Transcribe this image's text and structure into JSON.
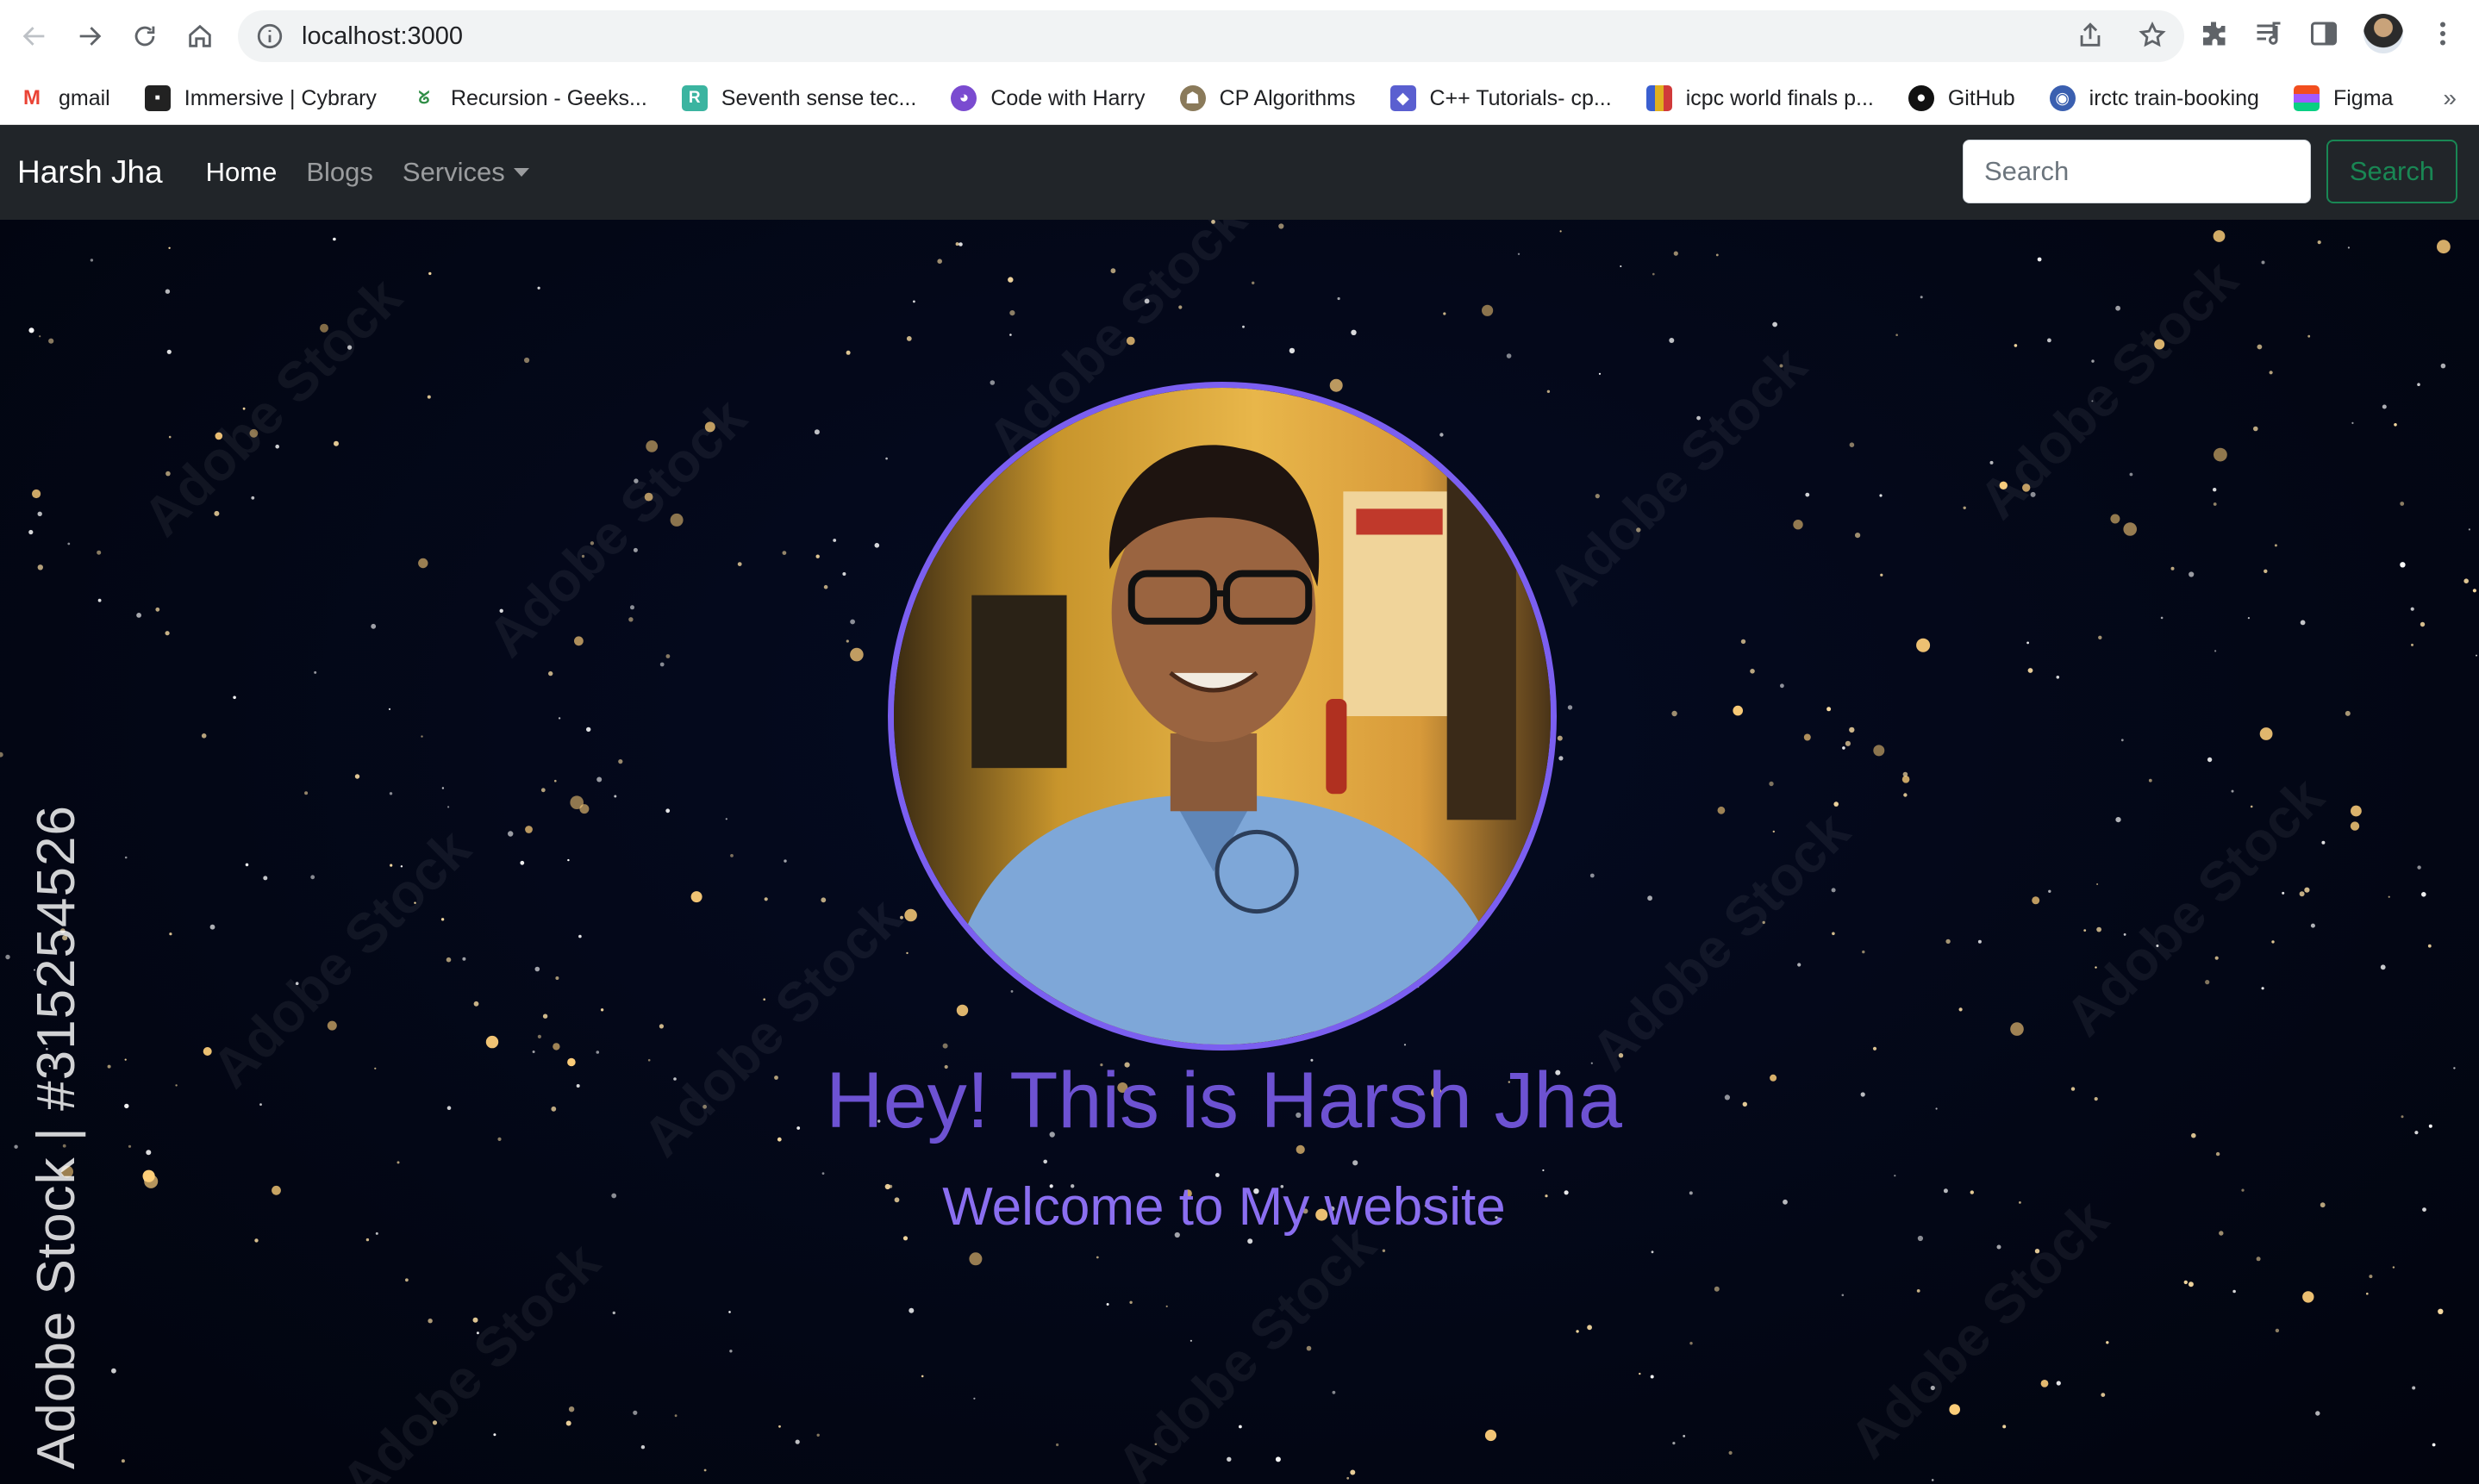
{
  "browser": {
    "url": "localhost:3000",
    "bookmarks": [
      {
        "label": "gmail",
        "icon": "gmail-icon",
        "color": "#ea4335"
      },
      {
        "label": "Immersive | Cybrary",
        "icon": "cybrary-icon",
        "color": "#222222"
      },
      {
        "label": "Recursion - Geeks...",
        "icon": "geeksforgeeks-icon",
        "color": "#2f8d46"
      },
      {
        "label": "Seventh sense tec...",
        "icon": "seventh-sense-icon",
        "color": "#3bb4a0"
      },
      {
        "label": "Code with Harry",
        "icon": "codewithharry-icon",
        "color": "#7a4bd0"
      },
      {
        "label": "CP Algorithms",
        "icon": "cp-algorithms-icon",
        "color": "#8a7a5a"
      },
      {
        "label": "C++ Tutorials- cp...",
        "icon": "cpp-tutorials-icon",
        "color": "#5a5fd0"
      },
      {
        "label": "icpc world finals p...",
        "icon": "icpc-icon",
        "color": "#e0b020"
      },
      {
        "label": "GitHub",
        "icon": "github-icon",
        "color": "#111111"
      },
      {
        "label": "irctc train-booking",
        "icon": "irctc-icon",
        "color": "#3a5fb0"
      },
      {
        "label": "Figma",
        "icon": "figma-icon",
        "color": "#f24e1e"
      }
    ],
    "more": "»"
  },
  "navbar": {
    "brand": "Harsh Jha",
    "links": [
      {
        "label": "Home"
      },
      {
        "label": "Blogs"
      },
      {
        "label": "Services"
      }
    ],
    "search_placeholder": "Search",
    "search_button": "Search",
    "colors": {
      "background": "#212529",
      "search_accent": "#198754"
    }
  },
  "hero": {
    "title": "Hey! This is Harsh Jha",
    "subtitle": "Welcome to My website",
    "watermark_side": "Adobe Stock | #315254526",
    "watermark_repeat": "Adobe Stock",
    "colors": {
      "title": "#6d52d2",
      "subtitle": "#8a6ef0",
      "avatar_border": "#7b5ff0"
    }
  }
}
